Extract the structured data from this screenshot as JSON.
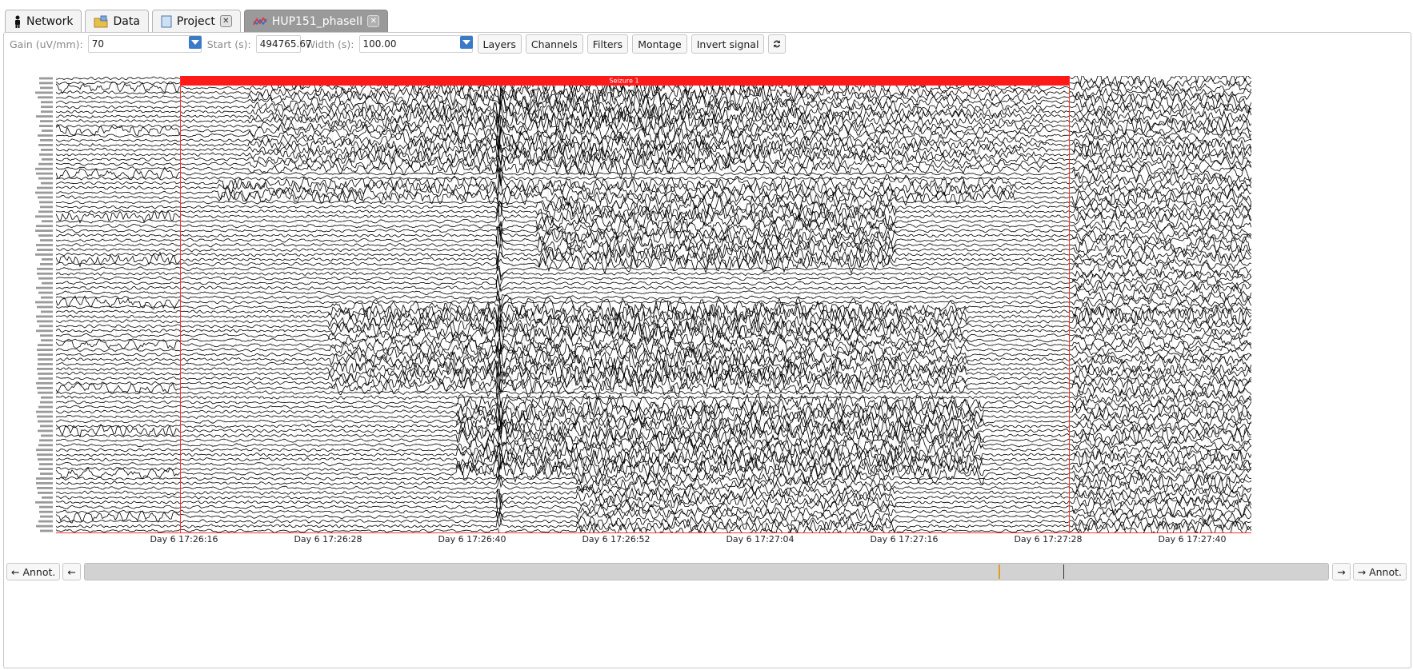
{
  "tabs": [
    {
      "label": "Network",
      "icon": "person-icon",
      "closable": false,
      "active": false
    },
    {
      "label": "Data",
      "icon": "folder-icon",
      "closable": false,
      "active": false
    },
    {
      "label": "Project",
      "icon": "document-icon",
      "closable": true,
      "active": false
    },
    {
      "label": "HUP151_phaseII",
      "icon": "signal-icon",
      "closable": true,
      "active": true
    }
  ],
  "toolbar": {
    "gain_label": "Gain (uV/mm):",
    "gain_value": "70",
    "start_label": "Start (s):",
    "start_value": "494765.67",
    "width_label": "Width (s):",
    "width_value": "100.00",
    "layers_label": "Layers",
    "channels_label": "Channels",
    "filters_label": "Filters",
    "montage_label": "Montage",
    "invert_label": "Invert signal",
    "refresh_icon": "swap-arrows-icon"
  },
  "annotation": {
    "label": "Seizure 1",
    "color": "#ff1a1a"
  },
  "time_axis": {
    "labels": [
      "Day 6 17:26:16",
      "Day 6 17:26:28",
      "Day 6 17:26:40",
      "Day 6 17:26:52",
      "Day 6 17:27:04",
      "Day 6 17:27:16",
      "Day 6 17:27:28",
      "Day 6 17:27:40"
    ]
  },
  "navigator": {
    "prev_annot_label": "← Annot.",
    "prev_label": "←",
    "next_label": "→",
    "next_annot_label": "→ Annot.",
    "position_fraction": 0.735
  },
  "signal_color": "#000000",
  "channel_count": 96
}
